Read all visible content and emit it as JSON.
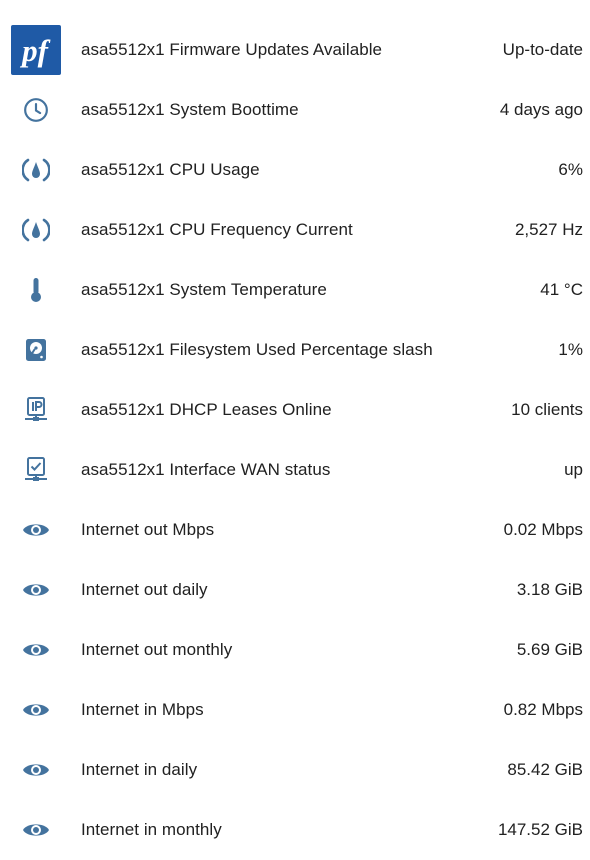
{
  "colors": {
    "icon": "#44739e",
    "text": "#212121",
    "logo_bg": "#1f5aa6"
  },
  "rows": [
    {
      "icon": "pfsense-logo-icon",
      "logo_text": "pf",
      "label": "asa5512x1 Firmware Updates Available",
      "value": "Up-to-date"
    },
    {
      "icon": "clock-icon",
      "label": "asa5512x1 System Boottime",
      "value": "4 days ago"
    },
    {
      "icon": "speedometer-icon",
      "label": "asa5512x1 CPU Usage",
      "value": "6%"
    },
    {
      "icon": "speedometer-icon",
      "label": "asa5512x1 CPU Frequency Current",
      "value": "2,527 Hz"
    },
    {
      "icon": "thermometer-icon",
      "label": "asa5512x1 System Temperature",
      "value": "41 °C"
    },
    {
      "icon": "harddisk-icon",
      "label": "asa5512x1 Filesystem Used Percentage slash",
      "value": "1%"
    },
    {
      "icon": "ip-network-icon",
      "label": "asa5512x1 DHCP Leases Online",
      "value": "10 clients"
    },
    {
      "icon": "network-check-icon",
      "label": "asa5512x1 Interface WAN status",
      "value": "up"
    },
    {
      "icon": "eye-icon",
      "label": "Internet out Mbps",
      "value": "0.02 Mbps"
    },
    {
      "icon": "eye-icon",
      "label": "Internet out daily",
      "value": "3.18 GiB"
    },
    {
      "icon": "eye-icon",
      "label": "Internet out monthly",
      "value": "5.69 GiB"
    },
    {
      "icon": "eye-icon",
      "label": "Internet in Mbps",
      "value": "0.82 Mbps"
    },
    {
      "icon": "eye-icon",
      "label": "Internet in daily",
      "value": "85.42 GiB"
    },
    {
      "icon": "eye-icon",
      "label": "Internet in monthly",
      "value": "147.52 GiB"
    }
  ]
}
